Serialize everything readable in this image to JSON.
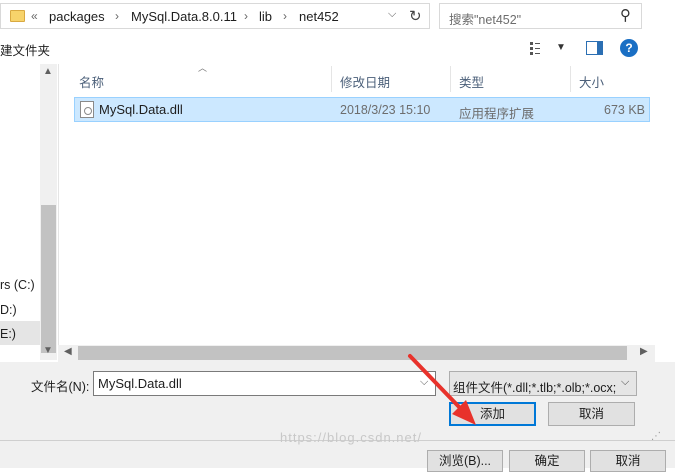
{
  "address_bar": {
    "overflow": "«",
    "crumbs": [
      "packages",
      "MySql.Data.8.0.11",
      "lib",
      "net452"
    ]
  },
  "search": {
    "placeholder": "搜索\"net452\""
  },
  "toolbar": {
    "new_folder": "建文件夹"
  },
  "nav_pane": {
    "items": [
      "rs (C:)",
      "D:)",
      "E:)"
    ]
  },
  "file_list": {
    "columns": [
      "名称",
      "修改日期",
      "类型",
      "大小"
    ],
    "rows": [
      {
        "name": "MySql.Data.dll",
        "modified": "2018/3/23 15:10",
        "type": "应用程序扩展",
        "size": "673 KB"
      }
    ]
  },
  "file_name": {
    "label": "文件名(N):",
    "value": "MySql.Data.dll"
  },
  "file_filter": {
    "value": "组件文件(*.dll;*.tlb;*.olb;*.ocx;"
  },
  "buttons": {
    "add": "添加",
    "cancel": "取消",
    "browse": "浏览(B)...",
    "ok": "确定",
    "cancel2": "取消"
  },
  "watermark": "https://blog.csdn.net/",
  "colors": {
    "accent": "#0078d7",
    "selection": "#cce8ff",
    "annotation_arrow": "#e8322b"
  }
}
